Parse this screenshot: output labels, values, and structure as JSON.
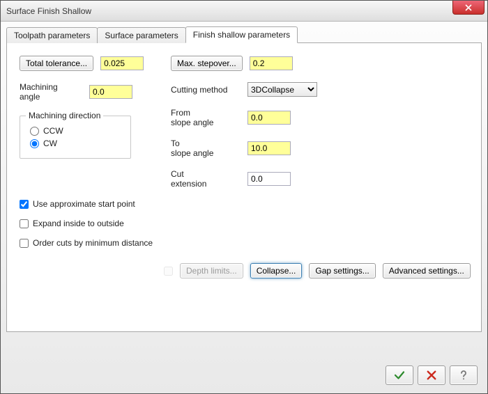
{
  "window": {
    "title": "Surface Finish Shallow"
  },
  "tabs": {
    "toolpath": "Toolpath parameters",
    "surface": "Surface parameters",
    "finish": "Finish shallow parameters",
    "active": "finish"
  },
  "left": {
    "total_tolerance_btn": "Total tolerance...",
    "total_tolerance_value": "0.025",
    "machining_angle_label": "Machining\nangle",
    "machining_angle_value": "0.0"
  },
  "machining_direction": {
    "legend": "Machining direction",
    "ccw_label": "CCW",
    "cw_label": "CW",
    "selected": "CW"
  },
  "right": {
    "max_stepover_btn": "Max. stepover...",
    "max_stepover_value": "0.2",
    "cutting_method_label": "Cutting method",
    "cutting_method_value": "3DCollapse",
    "from_slope_label": "From\nslope angle",
    "from_slope_value": "0.0",
    "to_slope_label": "To\nslope angle",
    "to_slope_value": "10.0",
    "cut_ext_label": "Cut\nextension",
    "cut_ext_value": "0.0"
  },
  "checks": {
    "approx_start": "Use approximate start point",
    "approx_start_checked": true,
    "expand": "Expand inside to outside",
    "expand_checked": false,
    "order_cuts": "Order cuts by minimum distance",
    "order_cuts_checked": false
  },
  "lower": {
    "depth_limits_btn": "Depth limits...",
    "depth_limits_enabled": false,
    "collapse_btn": "Collapse...",
    "gap_settings_btn": "Gap settings...",
    "advanced_btn": "Advanced settings..."
  },
  "footer": {
    "ok": "OK",
    "cancel": "Cancel",
    "help": "Help"
  }
}
